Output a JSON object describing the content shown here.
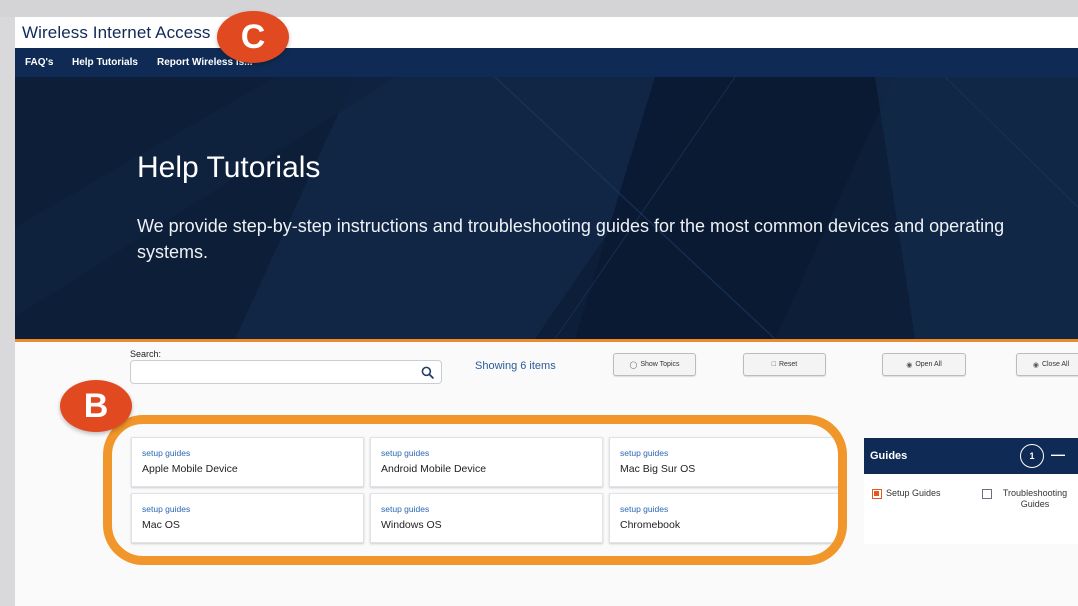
{
  "header": {
    "site_title": "Wireless Internet Access"
  },
  "nav": {
    "items": [
      "FAQ's",
      "Help Tutorials",
      "Report Wireless Is..."
    ]
  },
  "hero": {
    "title": "Help Tutorials",
    "subtitle": "We provide step-by-step instructions and troubleshooting guides for the  most common devices and operating systems."
  },
  "search": {
    "label": "Search:",
    "value": "",
    "placeholder": "",
    "icon": "search-icon"
  },
  "results": {
    "showing": "Showing 6 items"
  },
  "toolbar": {
    "show_topics": {
      "label": "Show Topics",
      "icon": "lightbulb-icon"
    },
    "reset": {
      "label": "Reset",
      "icon": "trash-icon"
    },
    "open_all": {
      "label": "Open All",
      "icon": "radio-icon"
    },
    "close_all": {
      "label": "Close All",
      "icon": "radio-icon"
    }
  },
  "cards": [
    {
      "category": "setup guides",
      "title": "Apple Mobile Device"
    },
    {
      "category": "setup guides",
      "title": "Android Mobile Device"
    },
    {
      "category": "setup guides",
      "title": "Mac Big Sur OS"
    },
    {
      "category": "setup guides",
      "title": "Mac OS"
    },
    {
      "category": "setup guides",
      "title": "Windows OS"
    },
    {
      "category": "setup guides",
      "title": "Chromebook"
    }
  ],
  "guides_panel": {
    "title": "Guides",
    "count": "1",
    "toggle": "—",
    "filters": [
      {
        "label": "Setup Guides",
        "checked": true
      },
      {
        "label": "Troubleshooting Guides",
        "checked": false
      }
    ]
  },
  "annotations": {
    "badge_b": "B",
    "badge_c": "C"
  },
  "colors": {
    "navy": "#0f2b55",
    "hero_bg": "#0c1e38",
    "accent_orange": "#f0962a",
    "badge_red": "#e14921",
    "link_blue": "#2a66b3"
  }
}
